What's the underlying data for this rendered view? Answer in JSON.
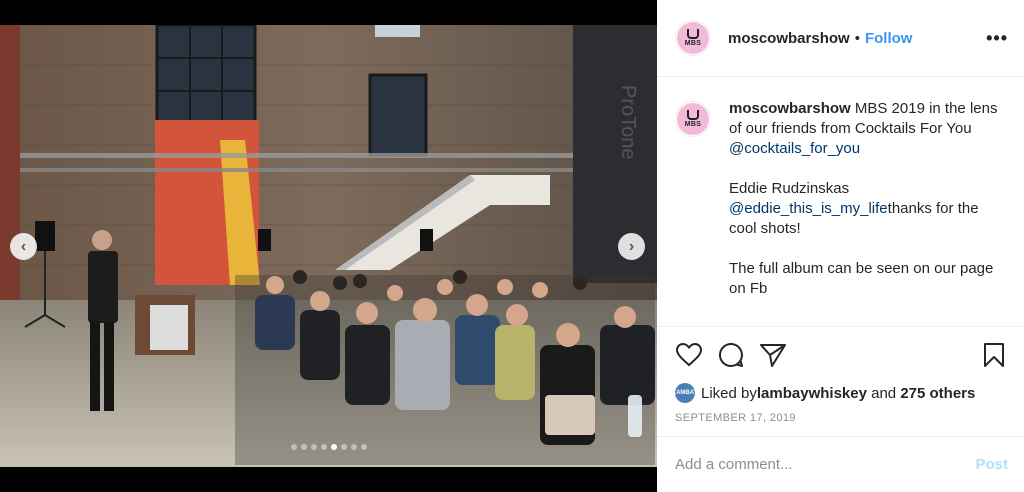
{
  "header": {
    "username": "moscowbarshow",
    "separator": "•",
    "follow_label": "Follow",
    "more_label": "•••"
  },
  "avatar": {
    "label": "MBS"
  },
  "caption": {
    "username": "moscowbarshow",
    "text1": " MBS 2019 in the lens of our friends from Cocktails For You ",
    "mention1": "@cocktails_for_you",
    "line2": "Eddie Rudzinskas",
    "mention2": "@eddie_this_is_my_life",
    "text2": "thanks for the cool shots!",
    "text3": "The full album can be seen on our page on Fb"
  },
  "likes": {
    "prefix": "Liked by ",
    "user": "lambaywhiskey",
    "middle": " and ",
    "others": "275 others",
    "avatar_label": "LAMBAY"
  },
  "date": "SEPTEMBER 17, 2019",
  "comment": {
    "placeholder": "Add a comment...",
    "post_label": "Post"
  },
  "carousel": {
    "prev": "‹",
    "next": "›",
    "slide_count": 8,
    "active_index": 4
  },
  "icons": [
    "heart-icon",
    "comment-icon",
    "share-icon",
    "bookmark-icon",
    "chevron-left-icon",
    "chevron-right-icon",
    "more-icon"
  ],
  "colors": {
    "link": "#3897f0",
    "mention": "#00376b",
    "post_disabled": "#b2dffc",
    "muted": "#8e8e8e"
  }
}
